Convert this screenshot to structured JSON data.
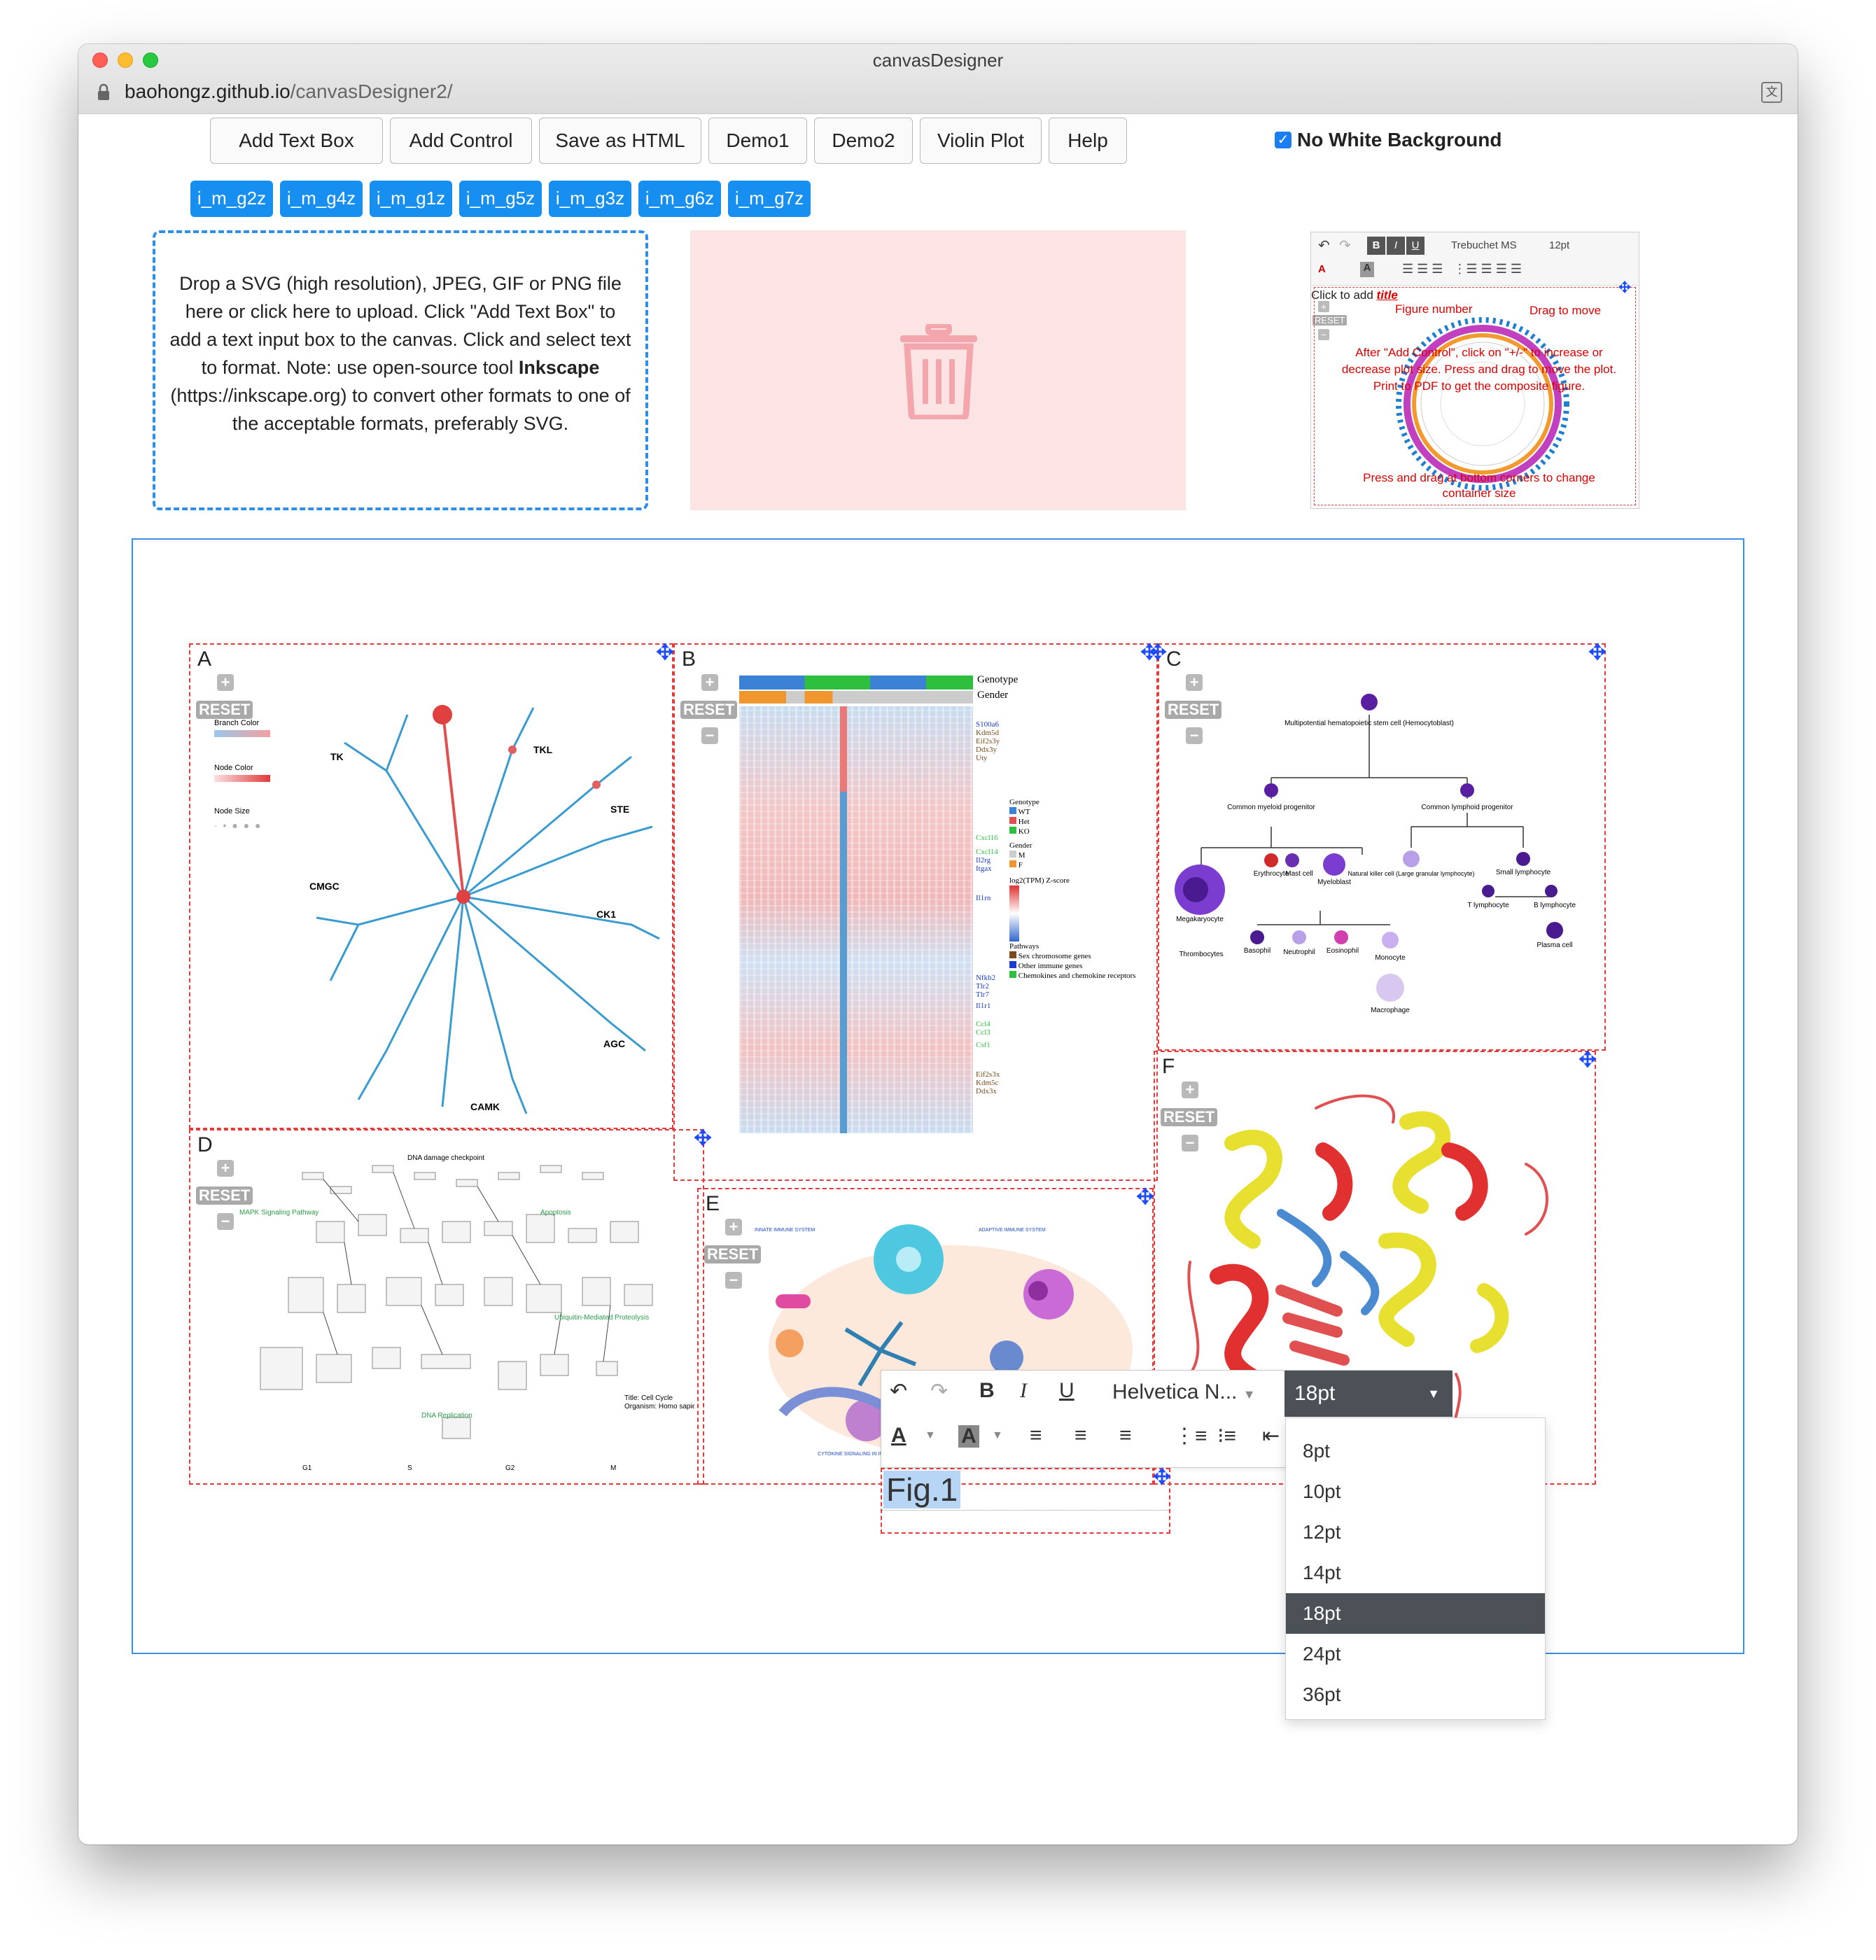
{
  "window": {
    "title": "canvasDesigner",
    "url_host": "baohongz.github.io",
    "url_path": "/canvasDesigner2/"
  },
  "toolbar": {
    "add_text_box": "Add Text Box",
    "add_control": "Add Control",
    "save_html": "Save as HTML",
    "demo1": "Demo1",
    "demo2": "Demo2",
    "violin": "Violin Plot",
    "help": "Help",
    "no_white_bg": "No White Background",
    "no_white_bg_checked": true
  },
  "tags": [
    "i_m_g2z",
    "i_m_g4z",
    "i_m_g1z",
    "i_m_g5z",
    "i_m_g3z",
    "i_m_g6z",
    "i_m_g7z"
  ],
  "dropzone": {
    "text_before": "Drop a SVG (high resolution), JPEG, GIF or PNG file here or click here to upload. Click \"Add Text Box\" to add a text input box to the canvas. Click and select text to format. Note: use open-source tool ",
    "bold": "Inkscape",
    "text_after": " (https://inkscape.org) to convert other formats to one of the acceptable formats, preferably SVG."
  },
  "trash": {
    "icon": "trash-icon",
    "color": "#f4a6ad"
  },
  "preview": {
    "font": "Trebuchet MS",
    "size": "12pt",
    "title_prefix": "Click to add ",
    "title_word": "title",
    "reset": "RESET",
    "hint_figure_number": "Figure number",
    "hint_drag": "Drag to move",
    "hint_control": "After \"Add Control\", click on \"+/-\" to increase or decrease plot size. Press and drag to move the plot. Print to PDF to get the composite figure.",
    "hint_resize": "Press and drag at bottom corners to change container size"
  },
  "panels": [
    {
      "label": "A",
      "reset": "RESET"
    },
    {
      "label": "B",
      "reset": "RESET"
    },
    {
      "label": "C",
      "reset": "RESET"
    },
    {
      "label": "D",
      "reset": "RESET"
    },
    {
      "label": "E",
      "reset": "RESET"
    },
    {
      "label": "F",
      "reset": "RESET"
    }
  ],
  "panel_a": {
    "legend": [
      "Branch Color",
      "Node Color",
      "Node Size"
    ],
    "groups": [
      "TK",
      "TKL",
      "STE",
      "CMGC",
      "CK1",
      "AGC",
      "CAMK"
    ]
  },
  "panel_b": {
    "annotations": [
      "Genotype",
      "Gender"
    ],
    "legend": [
      "Genotype",
      "Gender",
      "log2(TPM) Z-score",
      "Pathways"
    ],
    "pathways": [
      "Sex chromosome genes",
      "Other immune genes",
      "Chemokines and chemokine receptors"
    ],
    "genes": [
      "S100a6",
      "Kdm5d",
      "Eif2s3y",
      "Ddx3y",
      "Uty",
      "Cxcl16",
      "Cxcl14",
      "Il2rg",
      "Itgax",
      "Il1rn",
      "Nfkb2",
      "Tlr2",
      "Tlr7",
      "Il1r1",
      "Ccl4",
      "Ccl3",
      "Csf1",
      "Eif2s3x",
      "Kdm5c",
      "Ddx3x"
    ],
    "colors": {
      "wt": "#3b82d6",
      "ko": "#2fbf3f",
      "female": "#f0962e",
      "male": "#cccccc"
    }
  },
  "panel_c": {
    "nodes": [
      "Multipotential hematopoietic stem cell (Hemocytoblast)",
      "Common myeloid progenitor",
      "Common lymphoid progenitor",
      "Megakaryocyte",
      "Erythrocyte",
      "Mast cell",
      "Myeloblast",
      "Natural killer cell (Large granular lymphocyte)",
      "Small lymphocyte",
      "T lymphocyte",
      "B lymphocyte",
      "Plasma cell",
      "Thrombocytes",
      "Basophil",
      "Neutrophil",
      "Eosinophil",
      "Monocyte",
      "Macrophage"
    ]
  },
  "panel_d": {
    "title": "Title: Cell Cycle",
    "organism": "Organism: Homo sapiens",
    "phases": [
      "G1",
      "S",
      "G2",
      "M"
    ],
    "side_labels": [
      "MAPK Signaling Pathway",
      "Apoptosis",
      "Ubiquitin-Mediated Proteolysis",
      "DNA Replication",
      "DNA damage checkpoint"
    ]
  },
  "panel_e": {
    "labels": [
      "INNATE IMMUNE SYSTEM",
      "ADAPTIVE IMMUNE SYSTEM",
      "CYTOKINE SIGNALING IN IMMUNE SYSTEM"
    ]
  },
  "editor": {
    "font": "Helvetica N...",
    "size": "18pt",
    "size_options": [
      "8pt",
      "10pt",
      "12pt",
      "14pt",
      "18pt",
      "24pt",
      "36pt"
    ],
    "selected_size": "18pt"
  },
  "textbox": {
    "value": "Fig.1"
  }
}
